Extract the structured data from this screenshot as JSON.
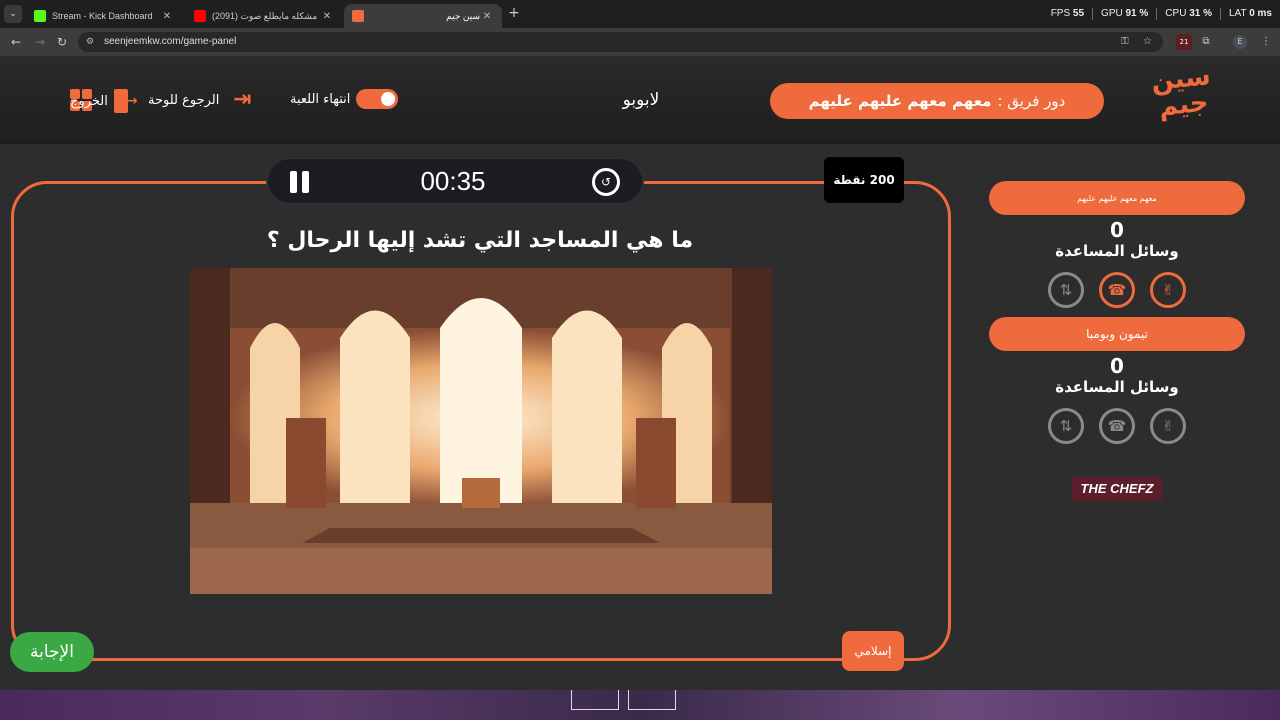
{
  "browser": {
    "tabs": [
      {
        "label": "Stream - Kick Dashboard",
        "fav_color": "#53fc18"
      },
      {
        "label": "(2091) حل مشكله مايطلع صوت",
        "fav_color": "#ff0000"
      },
      {
        "label": "سين جيم",
        "fav_color": "#ef6a3c"
      }
    ],
    "perf": {
      "fps_label": "FPS",
      "fps": "55",
      "gpu_label": "GPU",
      "gpu": "91 %",
      "cpu_label": "CPU",
      "cpu": "31 %",
      "lat_label": "LAT",
      "lat": "0 ms"
    },
    "url": "seenjeemkw.com/game-panel",
    "ext_badge": "21",
    "profile": "E"
  },
  "header": {
    "logo": "سين جيم",
    "turn_prefix": "دور فريق :",
    "turn_team": "معهم معهم عليهم عليهم",
    "game_name": "لابوبو",
    "end_game": "انتهاء اللعبة",
    "back_to_board": "الرجوع للوحة",
    "exit": "الخروج"
  },
  "question_panel": {
    "timer": "00:35",
    "points": "200 نقطة",
    "question": "ما هي المساجد التي تشد إليها الرحال ؟",
    "category": "إسلامي",
    "answer_button": "الإجابة"
  },
  "teams": [
    {
      "name": "معهم معهم عليهم عليهم",
      "score": "0",
      "aids_label": "وسائل المساعدة",
      "aids": [
        {
          "icon": "peace-hand-icon",
          "active": true
        },
        {
          "icon": "phone-icon",
          "active": true
        },
        {
          "icon": "swap-icon",
          "active": false
        }
      ]
    },
    {
      "name": "تيمون وبومبا",
      "score": "0",
      "aids_label": "وسائل المساعدة",
      "aids": [
        {
          "icon": "peace-hand-icon",
          "active": false
        },
        {
          "icon": "phone-icon",
          "active": false
        },
        {
          "icon": "swap-icon",
          "active": false
        }
      ]
    }
  ],
  "sponsor": "THE CHEFZ",
  "colors": {
    "accent": "#ef6a3c",
    "answer_green": "#3aa843"
  }
}
